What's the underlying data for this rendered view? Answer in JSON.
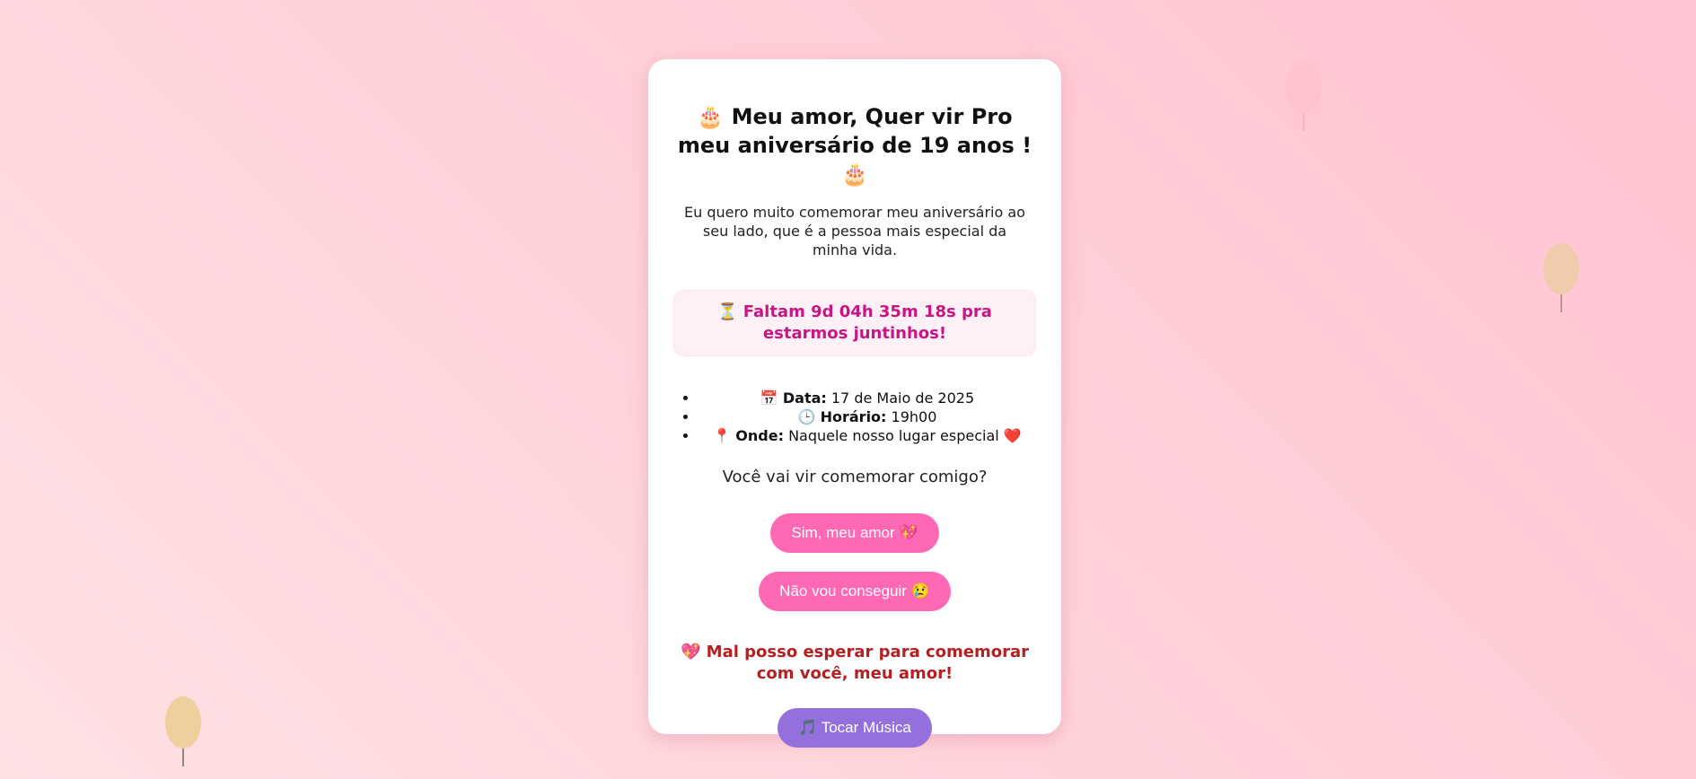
{
  "invite": {
    "title_icon": "🎂",
    "title": "Meu amor, Quer vir Pro meu aniversário de 19 anos !",
    "subtitle": "Eu quero muito comemorar meu aniversário ao seu lado, que é a pessoa mais especial da minha vida.",
    "countdown_icon": "⏳",
    "countdown_text": "Faltam 9d 04h 35m 18s pra estarmos juntinhos!",
    "details": [
      {
        "icon": "📅",
        "label": "Data:",
        "value": "17 de Maio de 2025"
      },
      {
        "icon": "🕒",
        "label": "Horário:",
        "value": "19h00"
      },
      {
        "icon": "📍",
        "label": "Onde:",
        "value": "Naquele nosso lugar especial",
        "suffix": "❤️"
      }
    ],
    "question": "Você vai vir comemorar comigo?",
    "yes_button": "Sim, meu amor 💖",
    "no_button": "Não vou conseguir 😢",
    "love_icon": "💖",
    "love_message": "Mal posso esperar para comemorar com você, meu amor!",
    "music_button": "🎵 Tocar Música"
  },
  "colors": {
    "accent_pink": "#ff69b4",
    "countdown_text": "#c71585",
    "love_text": "#b22222",
    "music_button": "#9370db"
  }
}
